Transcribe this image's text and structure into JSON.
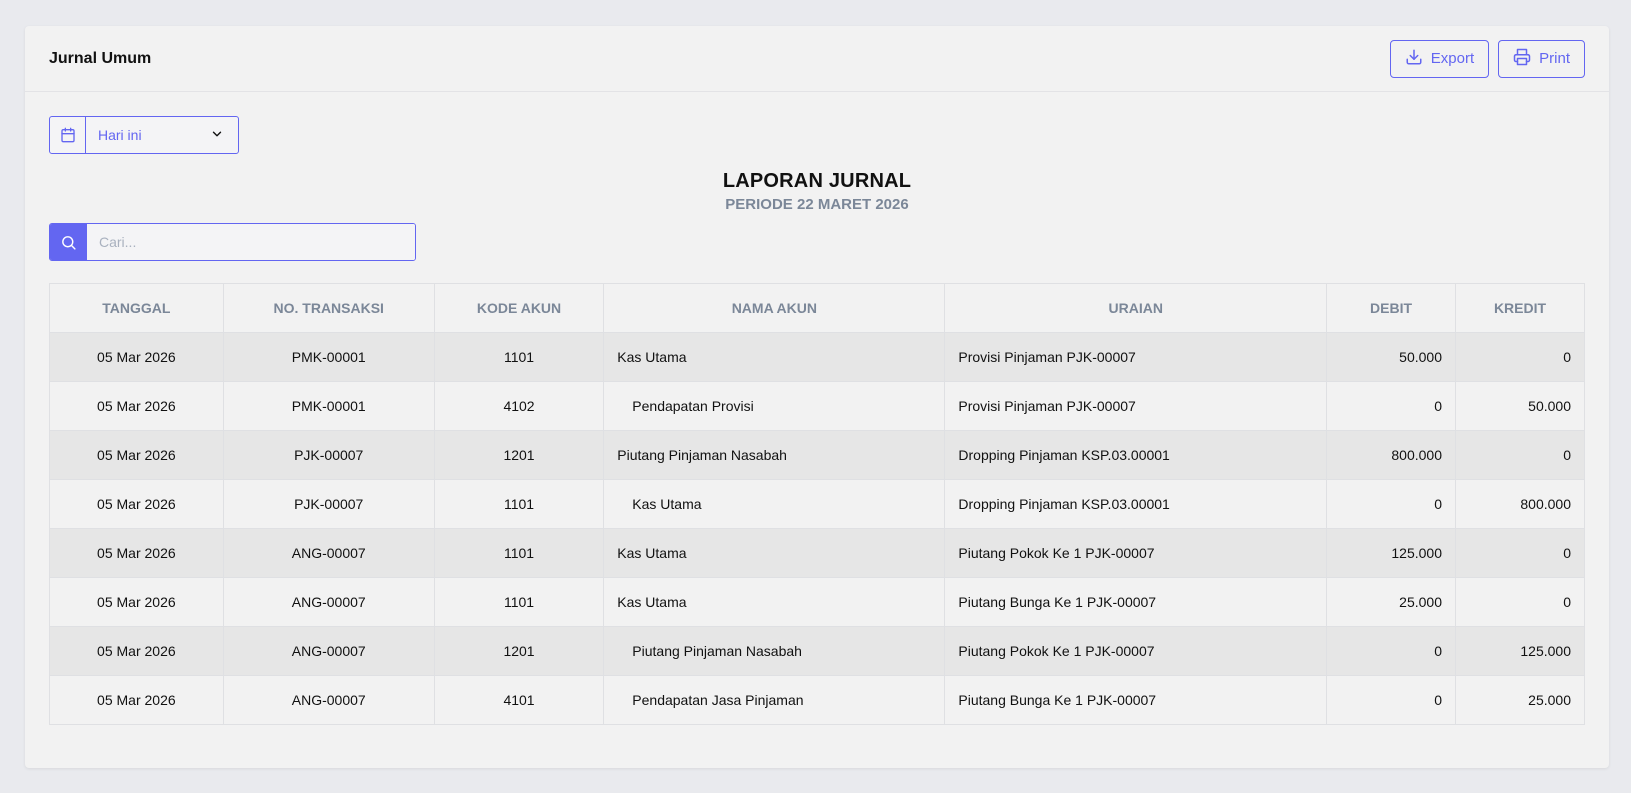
{
  "header": {
    "title": "Jurnal Umum",
    "export_label": "Export",
    "print_label": "Print"
  },
  "filter": {
    "date_value": "Hari ini"
  },
  "report": {
    "title": "LAPORAN JURNAL",
    "period": "PERIODE 22 MARET 2026"
  },
  "search": {
    "placeholder": "Cari..."
  },
  "colors": {
    "accent": "#6366f1",
    "muted": "#7b8798"
  },
  "table": {
    "columns": [
      "TANGGAL",
      "NO. TRANSAKSI",
      "KODE AKUN",
      "NAMA AKUN",
      "URAIAN",
      "DEBIT",
      "KREDIT"
    ],
    "rows": [
      {
        "date": "05 Mar 2026",
        "trx": "PMK-00001",
        "code": "1101",
        "name": "Kas Utama",
        "indent": false,
        "desc": "Provisi Pinjaman PJK-00007",
        "debit": "50.000",
        "credit": "0"
      },
      {
        "date": "05 Mar 2026",
        "trx": "PMK-00001",
        "code": "4102",
        "name": "Pendapatan Provisi",
        "indent": true,
        "desc": "Provisi Pinjaman PJK-00007",
        "debit": "0",
        "credit": "50.000"
      },
      {
        "date": "05 Mar 2026",
        "trx": "PJK-00007",
        "code": "1201",
        "name": "Piutang Pinjaman Nasabah",
        "indent": false,
        "desc": "Dropping Pinjaman KSP.03.00001",
        "debit": "800.000",
        "credit": "0"
      },
      {
        "date": "05 Mar 2026",
        "trx": "PJK-00007",
        "code": "1101",
        "name": "Kas Utama",
        "indent": true,
        "desc": "Dropping Pinjaman KSP.03.00001",
        "debit": "0",
        "credit": "800.000"
      },
      {
        "date": "05 Mar 2026",
        "trx": "ANG-00007",
        "code": "1101",
        "name": "Kas Utama",
        "indent": false,
        "desc": "Piutang Pokok Ke 1 PJK-00007",
        "debit": "125.000",
        "credit": "0"
      },
      {
        "date": "05 Mar 2026",
        "trx": "ANG-00007",
        "code": "1101",
        "name": "Kas Utama",
        "indent": false,
        "desc": "Piutang Bunga Ke 1 PJK-00007",
        "debit": "25.000",
        "credit": "0"
      },
      {
        "date": "05 Mar 2026",
        "trx": "ANG-00007",
        "code": "1201",
        "name": "Piutang Pinjaman Nasabah",
        "indent": true,
        "desc": "Piutang Pokok Ke 1 PJK-00007",
        "debit": "0",
        "credit": "125.000"
      },
      {
        "date": "05 Mar 2026",
        "trx": "ANG-00007",
        "code": "4101",
        "name": "Pendapatan Jasa Pinjaman",
        "indent": true,
        "desc": "Piutang Bunga Ke 1 PJK-00007",
        "debit": "0",
        "credit": "25.000"
      }
    ]
  }
}
